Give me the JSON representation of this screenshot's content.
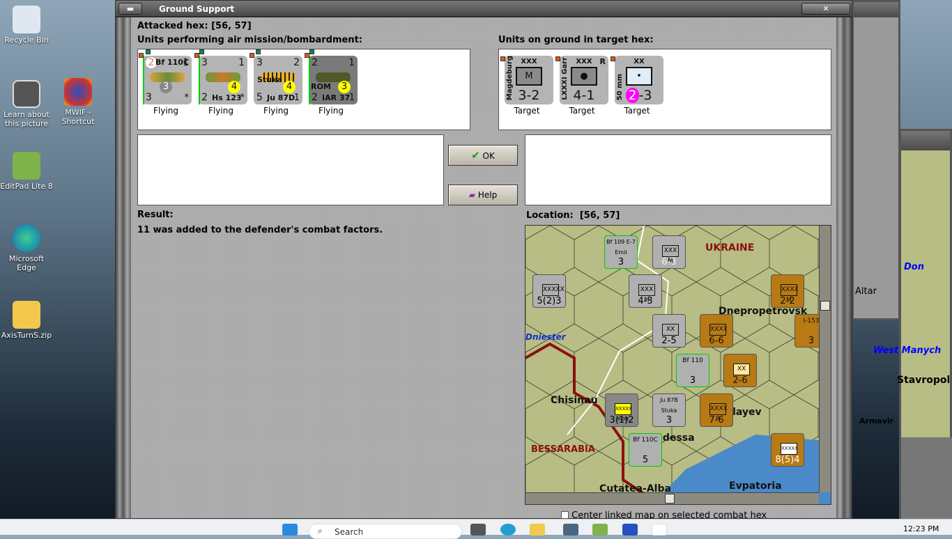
{
  "desktop": {
    "icons": [
      {
        "label": "Recycle Bin"
      },
      {
        "label": "Learn about this picture"
      },
      {
        "label": "MWIF - Shortcut"
      },
      {
        "label": "EditPad Lite 8"
      },
      {
        "label": "Microsoft Edge"
      },
      {
        "label": "AxisTurnS.zip"
      }
    ]
  },
  "window": {
    "title": "Ground Support",
    "close_glyph": "✕",
    "minimize_glyph": "▬"
  },
  "dialog": {
    "attacked_hex_label": "Attacked hex:",
    "attacked_hex": "[56, 57]",
    "air_units_label": "Units performing air mission/bombardment:",
    "ground_units_label": "Units on ground in target hex:",
    "air_units": [
      {
        "name": "Bf 110C",
        "top_left": "2",
        "top_right": "1",
        "bottom_left": "3",
        "circle": "3",
        "bottom_right": "*",
        "status": "Flying"
      },
      {
        "name": "Hs 123",
        "top_left": "3",
        "top_right": "1",
        "bottom_left": "2",
        "circle": "4",
        "bottom_right": "*",
        "status": "Flying"
      },
      {
        "name": "Ju 87D",
        "nickname": "Stuka",
        "top_left": "3",
        "top_right": "2",
        "bottom_left": "5",
        "circle": "4",
        "bottom_right": "1",
        "status": "Flying"
      },
      {
        "name": "IAR 37",
        "nickname": "ROM",
        "top_left": "2",
        "top_right": "1",
        "bottom_left": "2",
        "circle": "3",
        "bottom_right": "1",
        "status": "Flying"
      }
    ],
    "ground_units": [
      {
        "name": "Magdeburg",
        "size": "XXX",
        "symbol": "M",
        "strength": "3-2",
        "status": "Target"
      },
      {
        "name": "LXXXI Garr",
        "size": "XXX",
        "flag": "R",
        "symbol": "●",
        "strength": "4-1",
        "status": "Target"
      },
      {
        "name": "50 mm",
        "size": "XX",
        "symbol": "•",
        "strength_circle": "2",
        "strength_rest": "-3",
        "status": "Target"
      }
    ],
    "ok_label": "OK",
    "help_label": "Help",
    "result_label": "Result:",
    "result_text": "11 was added to the defender's combat factors.",
    "location_label": "Location:",
    "location": "[56, 57]",
    "center_checkbox_label": "Center linked map on selected combat hex",
    "center_checkbox_checked": false
  },
  "map": {
    "places": [
      "UKRAINE",
      "Dnepropetrovsk",
      "Chisinau",
      "BESSARABIA",
      "Odessa",
      "Nikolayev",
      "Cutatea-Alba",
      "Evpatoria",
      "Dniester"
    ],
    "counters": [
      {
        "name": "Bf 109 E-7 Emil",
        "value": "3"
      },
      {
        "name": "XXX M",
        "value": "6-3"
      },
      {
        "name": "XXXXX",
        "value": "5(2)3"
      },
      {
        "name": "XXX M",
        "value": "4-3"
      },
      {
        "name": "XXXX M",
        "value": "2-2"
      },
      {
        "name": "XX",
        "value": "2-5"
      },
      {
        "name": "XXXX",
        "value": "6-6"
      },
      {
        "name": "I-153",
        "value": "3"
      },
      {
        "name": "Bf 110",
        "value": "3"
      },
      {
        "name": "XX",
        "value": "2-6"
      },
      {
        "name": "XXXXX ROM",
        "value": "3(1)2"
      },
      {
        "name": "Ju 87B Stuka",
        "value": "3"
      },
      {
        "name": "XXXX R",
        "value": "7-6"
      },
      {
        "name": "Bf 110C",
        "value": "5"
      },
      {
        "name": "XXXXX",
        "value": "8(5)4"
      }
    ]
  },
  "background_map": {
    "labels": [
      "Don",
      "West Manych",
      "Stavropol",
      "Altar",
      "Armavir"
    ]
  },
  "taskbar": {
    "search_placeholder": "Search",
    "time": "12:23 PM"
  }
}
